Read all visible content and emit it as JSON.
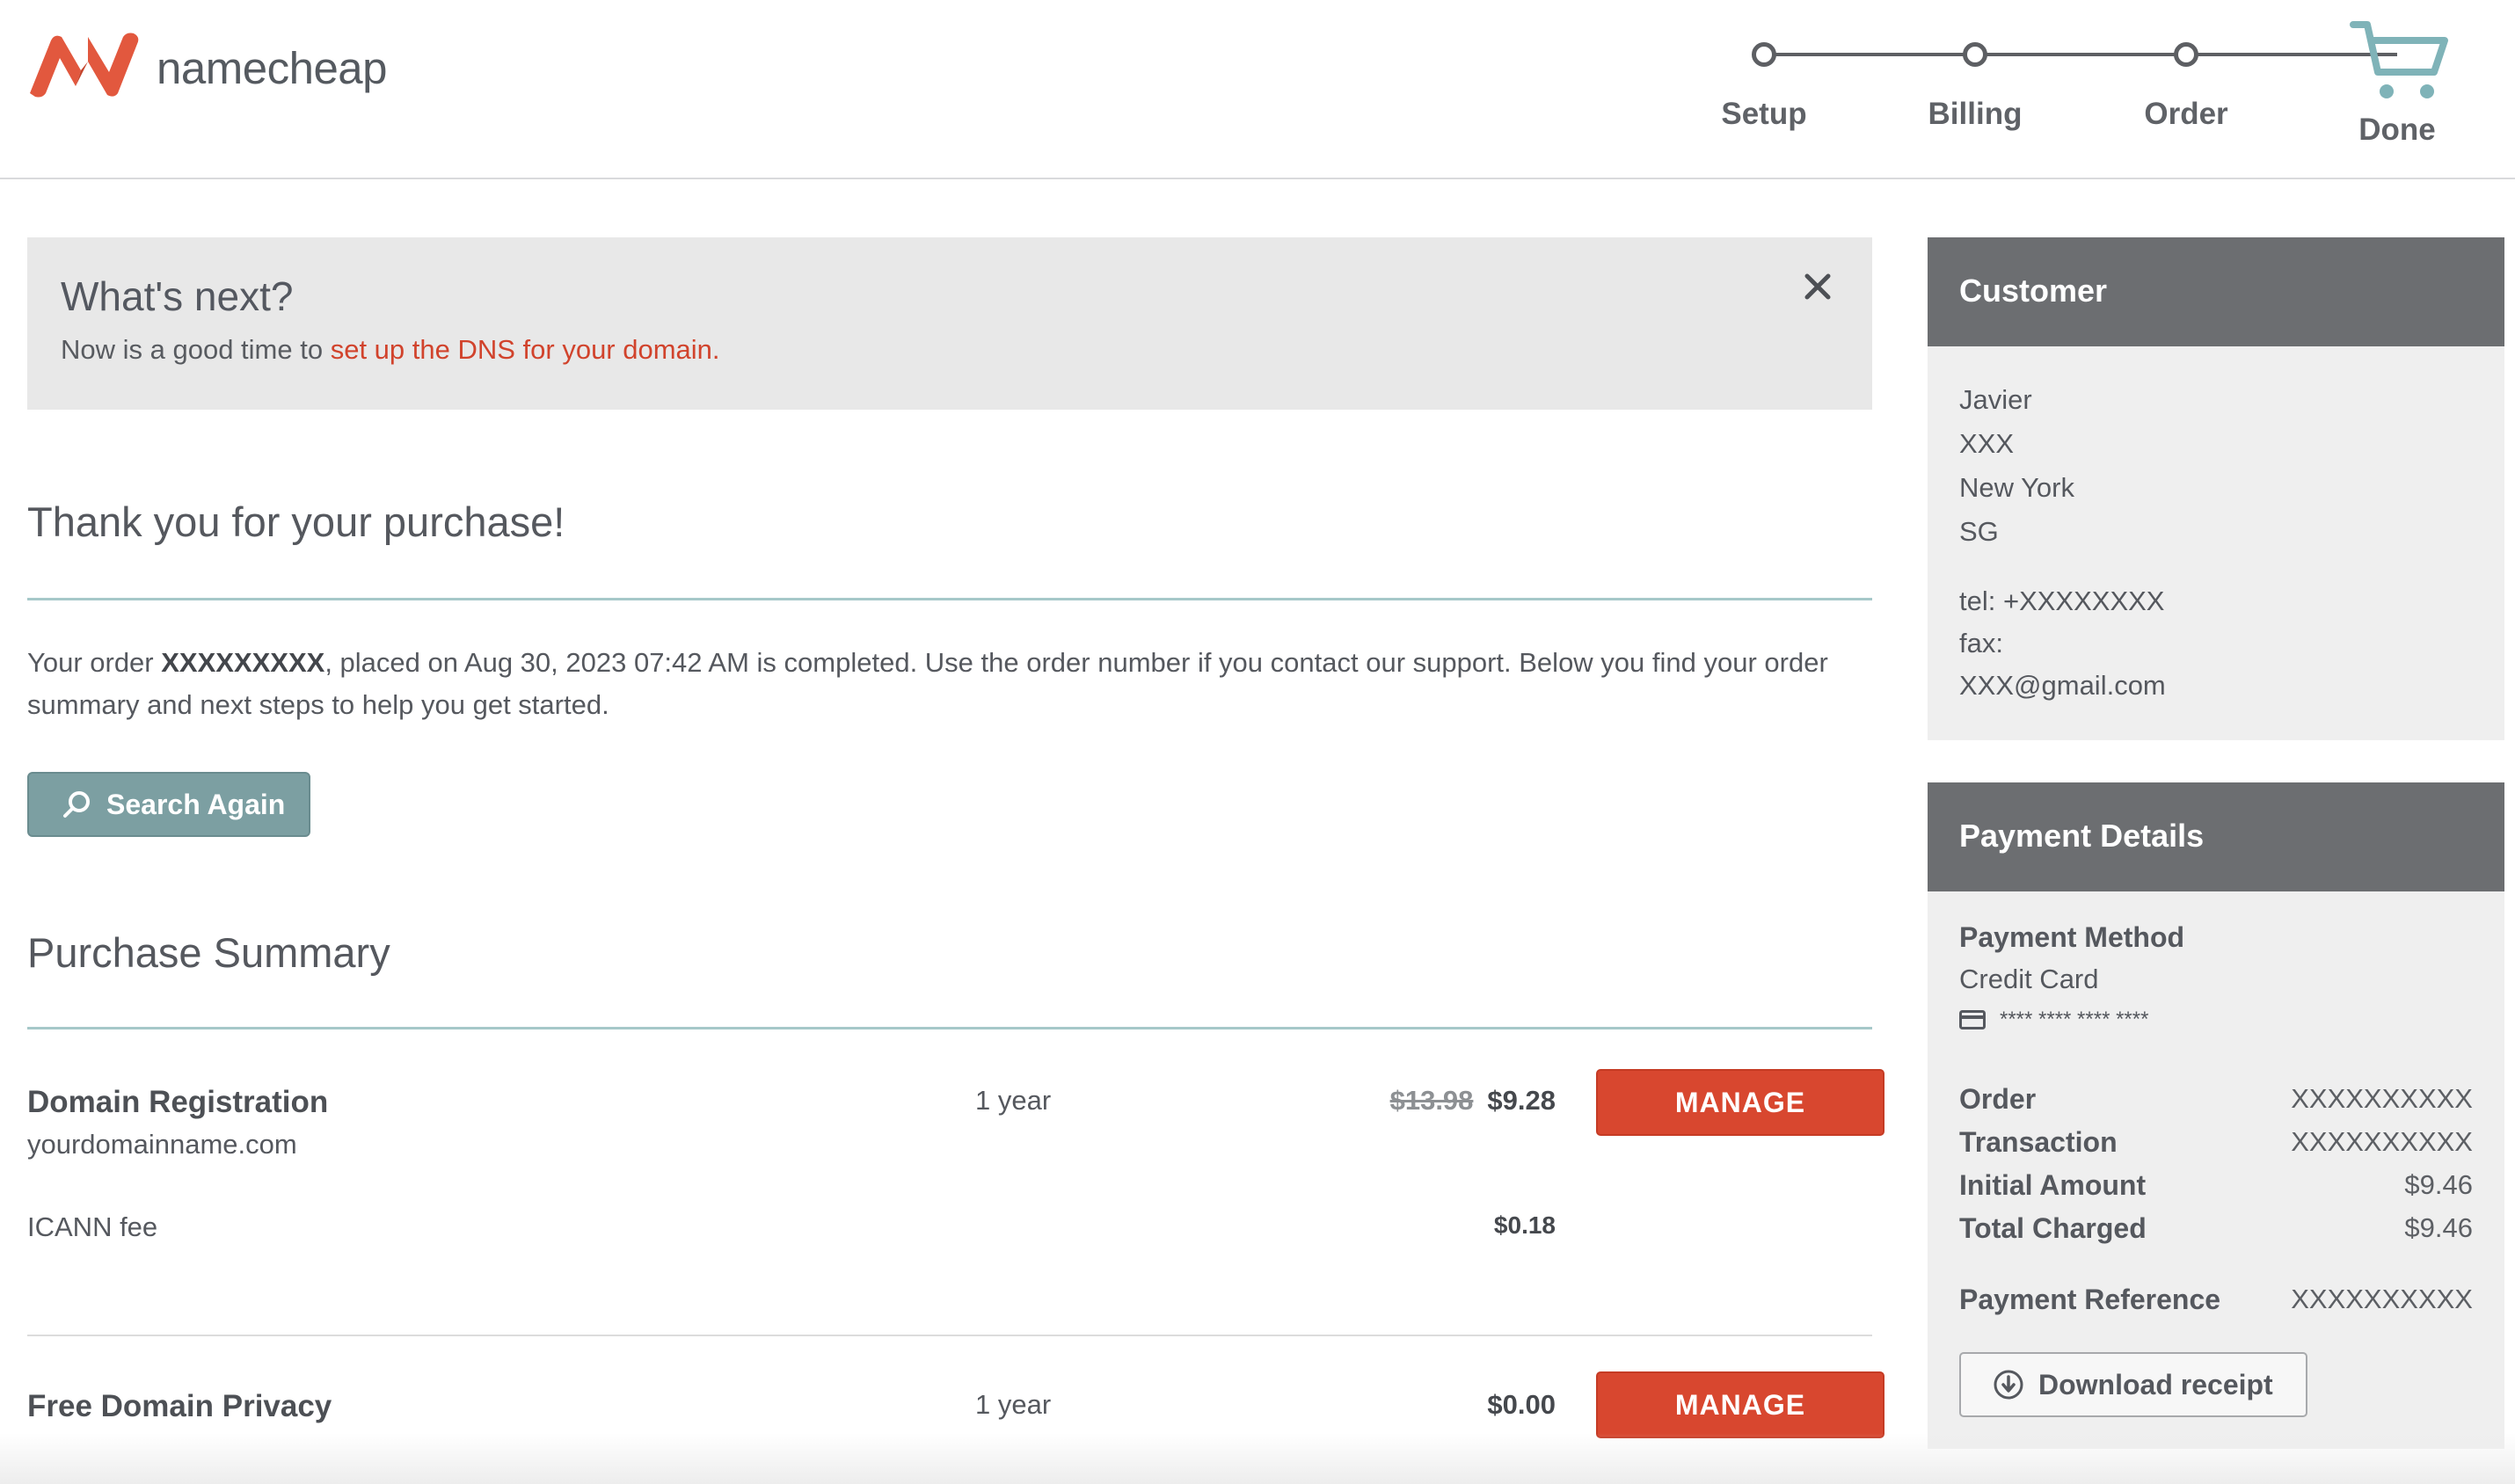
{
  "brand": {
    "name": "namecheap",
    "logo_color": "#e2583e"
  },
  "steps": [
    {
      "label": "Setup"
    },
    {
      "label": "Billing"
    },
    {
      "label": "Order"
    },
    {
      "label": "Done"
    }
  ],
  "whats_next": {
    "title": "What's next?",
    "text_prefix": "Now is a good time to ",
    "link_text": "set up the DNS for your domain."
  },
  "thanks": {
    "heading": "Thank you for your purchase!",
    "order_prefix": "Your order ",
    "order_number": "XXXXXXXXX",
    "order_suffix": ", placed on Aug 30, 2023 07:42 AM is completed. Use the order number if you contact our support. Below you find your order summary and next steps to help you get started."
  },
  "search_again_label": "Search Again",
  "summary": {
    "title": "Purchase Summary",
    "items": [
      {
        "name": "Domain Registration",
        "domain": "yourdomainname.com",
        "period": "1 year",
        "old_price": "$13.98",
        "price": "$9.28",
        "manage_label": "MANAGE",
        "fee_label": "ICANN fee",
        "fee_price": "$0.18"
      },
      {
        "name": "Free Domain Privacy",
        "period": "1 year",
        "price": "$0.00",
        "manage_label": "MANAGE"
      }
    ]
  },
  "customer": {
    "title": "Customer",
    "lines": [
      "Javier",
      "XXX",
      "New York",
      "SG"
    ],
    "tel": "tel: +XXXXXXXX",
    "fax": "fax:",
    "email": "XXX@gmail.com"
  },
  "payment": {
    "title": "Payment Details",
    "method_label": "Payment Method",
    "method_value": "Credit Card",
    "card_mask": "**** **** **** ****",
    "rows": [
      {
        "label": "Order",
        "value": "XXXXXXXXXX"
      },
      {
        "label": "Transaction",
        "value": "XXXXXXXXXX"
      },
      {
        "label": "Initial Amount",
        "value": "$9.46"
      },
      {
        "label": "Total Charged",
        "value": "$9.46"
      }
    ],
    "reference_label": "Payment Reference",
    "reference_value": "XXXXXXXXXX",
    "download_label": "Download receipt"
  },
  "colors": {
    "accent_red": "#d8472f",
    "teal_button": "#7c9fa2",
    "panel_header": "#6c6e71",
    "cart_teal": "#7fb3b8"
  }
}
